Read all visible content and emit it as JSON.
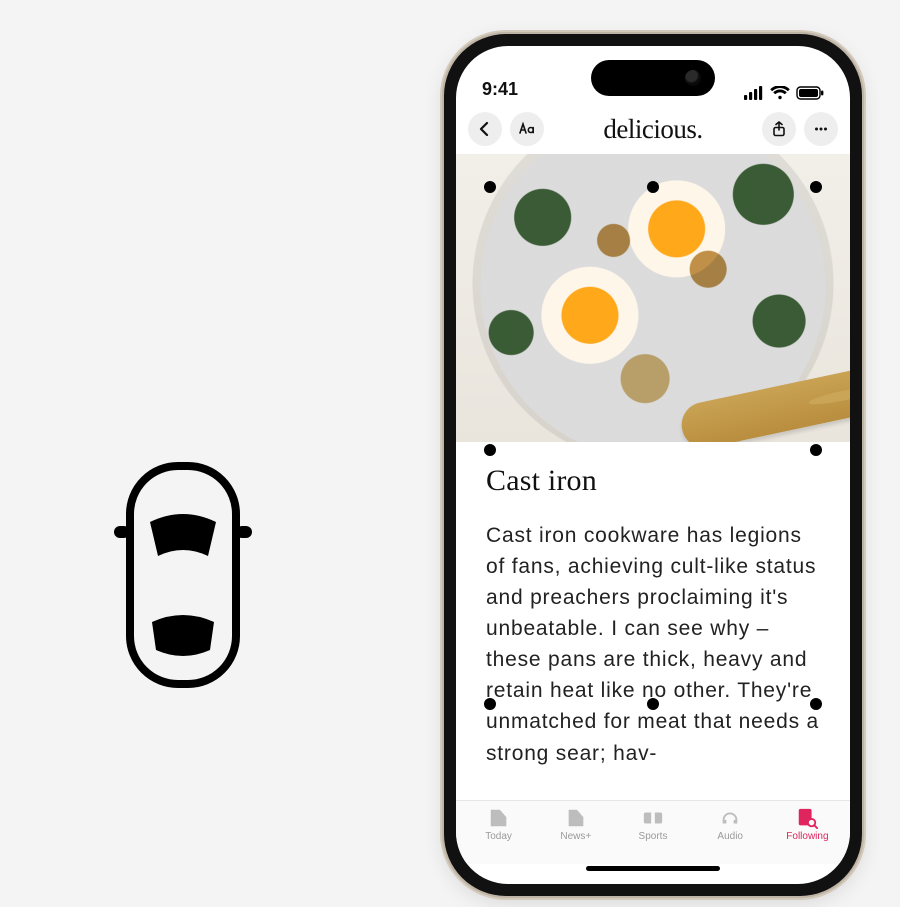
{
  "status": {
    "time": "9:41"
  },
  "header": {
    "brand": "delicious."
  },
  "article": {
    "title": "Cast iron",
    "body": "Cast iron cookware has legions of fans, achieving cult-like status and preachers proclaiming it's unbeatable. I can see why – these pans are thick, heavy and retain heat like no other. They're unmatched for meat that needs a strong sear; hav-"
  },
  "tabs": {
    "today": {
      "label": "Today"
    },
    "newsplus": {
      "label": "News+"
    },
    "sports": {
      "label": "Sports"
    },
    "audio": {
      "label": "Audio"
    },
    "following": {
      "label": "Following"
    }
  },
  "colors": {
    "accent": "#e0245e"
  }
}
